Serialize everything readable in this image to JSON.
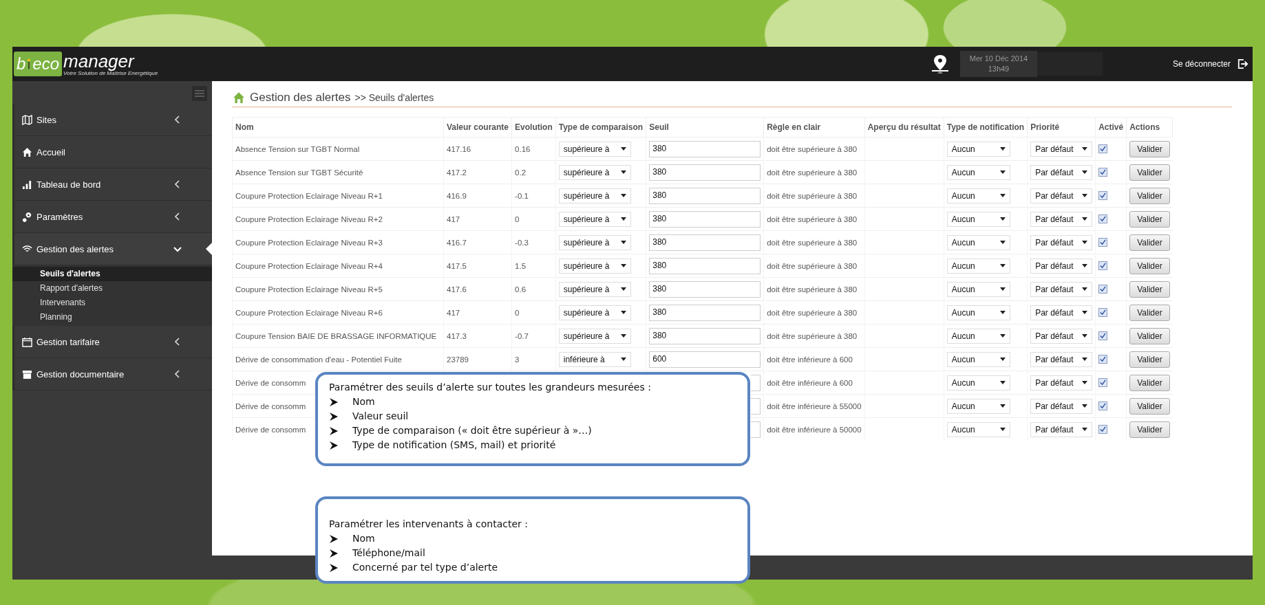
{
  "header": {
    "logo_left": "b",
    "logo_right": "eco",
    "logo_word": "manager",
    "tagline": "Votre Solution de Maîtrise Energétique",
    "date": "Mer 10 Déc 2014",
    "time": "13h49",
    "logout": "Se déconnecter"
  },
  "sidebar": {
    "items": [
      {
        "label": "Sites",
        "kind": "group",
        "expanded": false,
        "selected": false
      },
      {
        "label": "Accueil",
        "kind": "link",
        "selected": false
      },
      {
        "label": "Tableau de bord",
        "kind": "group",
        "expanded": false,
        "selected": false
      },
      {
        "label": "Paramètres",
        "kind": "group",
        "expanded": false,
        "selected": false
      },
      {
        "label": "Gestion des alertes",
        "kind": "group",
        "expanded": true,
        "selected": true,
        "children": [
          {
            "label": "Seuils d'alertes",
            "selected": true
          },
          {
            "label": "Rapport d'alertes",
            "selected": false
          },
          {
            "label": "Intervenants",
            "selected": false
          },
          {
            "label": "Planning",
            "selected": false
          }
        ]
      },
      {
        "label": "Gestion tarifaire",
        "kind": "group",
        "expanded": false,
        "selected": false
      },
      {
        "label": "Gestion documentaire",
        "kind": "group",
        "expanded": false,
        "selected": false
      }
    ]
  },
  "page": {
    "title": "Gestion des alertes",
    "subtitle": ">> Seuils d'alertes"
  },
  "table": {
    "columns": [
      "Nom",
      "Valeur courante",
      "Evolution",
      "Type de comparaison",
      "Seuil",
      "Règle en clair",
      "Aperçu du résultat",
      "Type de notification",
      "Priorité",
      "Activé",
      "Actions"
    ],
    "rows": [
      {
        "name": "Absence Tension sur TGBT Normal",
        "value": "417.16",
        "evolution": "0.16",
        "comparison": "supérieure à",
        "threshold": "380",
        "rule": "doit être supérieure à 380",
        "notification": "Aucun",
        "priority": "Par défaut",
        "active": true,
        "action": "Valider"
      },
      {
        "name": "Absence Tension sur TGBT Sécurité",
        "value": "417.2",
        "evolution": "0.2",
        "comparison": "supérieure à",
        "threshold": "380",
        "rule": "doit être supérieure à 380",
        "notification": "Aucun",
        "priority": "Par défaut",
        "active": true,
        "action": "Valider"
      },
      {
        "name": "Coupure Protection Eclairage Niveau R+1",
        "value": "416.9",
        "evolution": "-0.1",
        "comparison": "supérieure à",
        "threshold": "380",
        "rule": "doit être supérieure à 380",
        "notification": "Aucun",
        "priority": "Par défaut",
        "active": true,
        "action": "Valider"
      },
      {
        "name": "Coupure Protection Eclairage Niveau R+2",
        "value": "417",
        "evolution": "0",
        "comparison": "supérieure à",
        "threshold": "380",
        "rule": "doit être supérieure à 380",
        "notification": "Aucun",
        "priority": "Par défaut",
        "active": true,
        "action": "Valider"
      },
      {
        "name": "Coupure Protection Eclairage Niveau R+3",
        "value": "416.7",
        "evolution": "-0.3",
        "comparison": "supérieure à",
        "threshold": "380",
        "rule": "doit être supérieure à 380",
        "notification": "Aucun",
        "priority": "Par défaut",
        "active": true,
        "action": "Valider"
      },
      {
        "name": "Coupure Protection Eclairage Niveau R+4",
        "value": "417.5",
        "evolution": "1.5",
        "comparison": "supérieure à",
        "threshold": "380",
        "rule": "doit être supérieure à 380",
        "notification": "Aucun",
        "priority": "Par défaut",
        "active": true,
        "action": "Valider"
      },
      {
        "name": "Coupure Protection Eclairage Niveau R+5",
        "value": "417.6",
        "evolution": "0.6",
        "comparison": "supérieure à",
        "threshold": "380",
        "rule": "doit être supérieure à 380",
        "notification": "Aucun",
        "priority": "Par défaut",
        "active": true,
        "action": "Valider"
      },
      {
        "name": "Coupure Protection Eclairage Niveau R+6",
        "value": "417",
        "evolution": "0",
        "comparison": "supérieure à",
        "threshold": "380",
        "rule": "doit être supérieure à 380",
        "notification": "Aucun",
        "priority": "Par défaut",
        "active": true,
        "action": "Valider"
      },
      {
        "name": "Coupure Tension BAIE DE BRASSAGE INFORMATIQUE",
        "value": "417.3",
        "evolution": "-0.7",
        "comparison": "supérieure à",
        "threshold": "380",
        "rule": "doit être supérieure à 380",
        "notification": "Aucun",
        "priority": "Par défaut",
        "active": true,
        "action": "Valider"
      },
      {
        "name": "Dérive de consommation d'eau - Potentiel Fuite",
        "value": "23789",
        "evolution": "3",
        "comparison": "inférieure à",
        "threshold": "600",
        "rule": "doit être inférieure à 600",
        "notification": "Aucun",
        "priority": "Par défaut",
        "active": true,
        "action": "Valider"
      },
      {
        "name": "Dérive de consomm",
        "rule": "doit être inférieure à 600",
        "notification": "Aucun",
        "priority": "Par défaut",
        "active": true,
        "action": "Valider"
      },
      {
        "name": "Dérive de consomm",
        "rule": "doit être inférieure à 55000",
        "notification": "Aucun",
        "priority": "Par défaut",
        "active": true,
        "action": "Valider"
      },
      {
        "name": "Dérive de consomm",
        "rule": "doit être inférieure à 50000",
        "notification": "Aucun",
        "priority": "Par défaut",
        "active": true,
        "action": "Valider"
      }
    ]
  },
  "callouts": [
    {
      "title": "Paramétrer des seuils d’alerte sur toutes les grandeurs mesurées :",
      "bullets": [
        "Nom",
        "Valeur seuil",
        "Type de comparaison (« doit être supérieur à »…)",
        "Type de notification (SMS, mail) et priorité"
      ]
    },
    {
      "title": "Paramétrer les intervenants à contacter :",
      "bullets": [
        "Nom",
        "Téléphone/mail",
        "Concerné par tel type d’alerte"
      ]
    }
  ]
}
